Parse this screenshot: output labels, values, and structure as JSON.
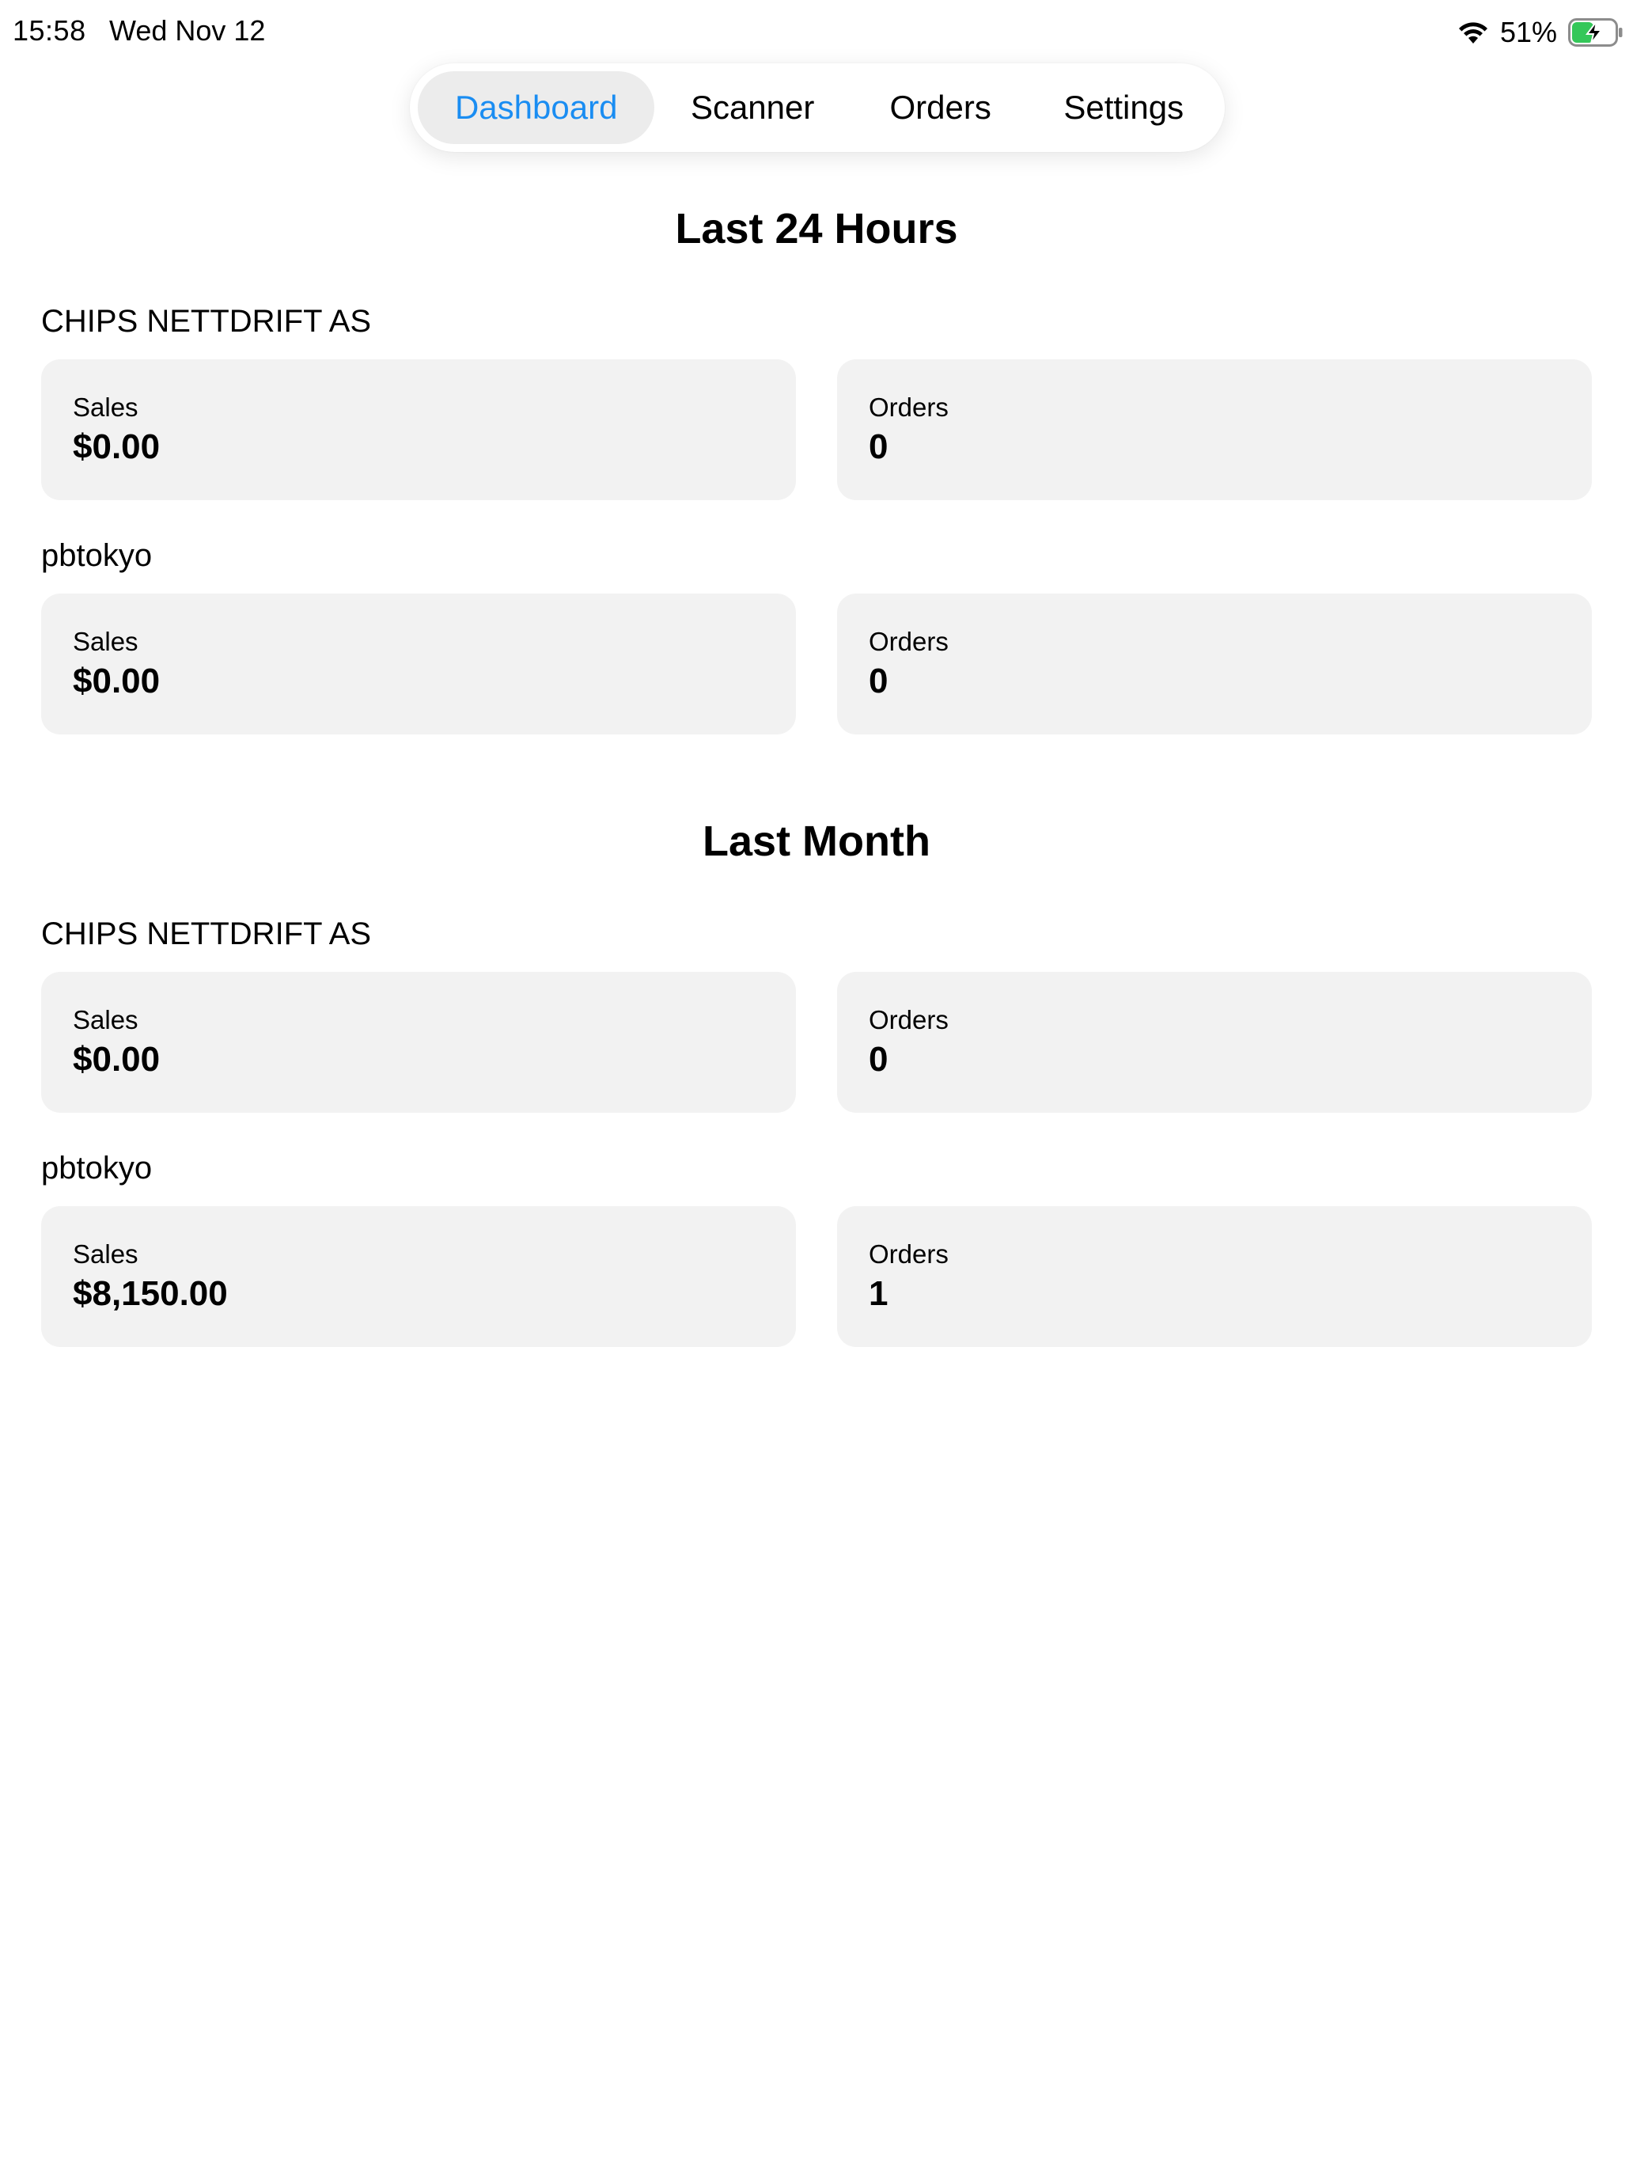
{
  "status_bar": {
    "time": "15:58",
    "date": "Wed Nov 12",
    "battery_percent": "51%",
    "battery_level": 0.51,
    "charging": true,
    "wifi_icon": "wifi-icon",
    "battery_icon": "battery-charging-icon"
  },
  "tabs": [
    {
      "label": "Dashboard",
      "active": true
    },
    {
      "label": "Scanner",
      "active": false
    },
    {
      "label": "Orders",
      "active": false
    },
    {
      "label": "Settings",
      "active": false
    }
  ],
  "colors": {
    "accent": "#1a8df2",
    "card_bg": "#f2f2f2",
    "active_tab_bg": "#ececec",
    "battery_green": "#34c759"
  },
  "sections": [
    {
      "title": "Last 24 Hours",
      "stores": [
        {
          "name": "CHIPS NETTDRIFT AS",
          "sales_label": "Sales",
          "sales_value": "$0.00",
          "orders_label": "Orders",
          "orders_value": "0"
        },
        {
          "name": "pbtokyo",
          "sales_label": "Sales",
          "sales_value": "$0.00",
          "orders_label": "Orders",
          "orders_value": "0"
        }
      ]
    },
    {
      "title": "Last Month",
      "stores": [
        {
          "name": "CHIPS NETTDRIFT AS",
          "sales_label": "Sales",
          "sales_value": "$0.00",
          "orders_label": "Orders",
          "orders_value": "0"
        },
        {
          "name": "pbtokyo",
          "sales_label": "Sales",
          "sales_value": "$8,150.00",
          "orders_label": "Orders",
          "orders_value": "1"
        }
      ]
    }
  ]
}
